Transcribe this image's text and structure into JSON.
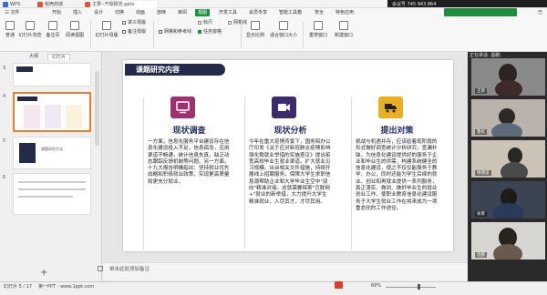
{
  "titlebar": {
    "tabs": [
      {
        "label": "WPS",
        "color": "#2e6fe0"
      },
      {
        "label": "稻壳商城",
        "color": "#e0533a"
      },
      {
        "label": "主要--开题报告.pptx",
        "color": "#e0533a"
      }
    ],
    "meeting": "会议号 745 943 864"
  },
  "menubar": {
    "items": [
      "三 文件",
      "开始",
      "插入",
      "设计",
      "切换",
      "动画",
      "放映",
      "审阅",
      "视图",
      "开发工具",
      "会员专享",
      "智能工具箱",
      "安全",
      "特色应用"
    ],
    "active_index": 8,
    "right": "已"
  },
  "ribbon": {
    "big_buttons": [
      "普通",
      "幻灯片浏览",
      "备注页",
      "阅读视图",
      "幻灯片母版",
      "讲义母版",
      "备注母版",
      "网格和参考线",
      "任务窗格",
      "显示比例",
      "适合窗口大小",
      "重排窗口",
      "新建窗口"
    ],
    "small_items": [
      "标尺",
      "网格线",
      "参考线",
      "任务窗格"
    ],
    "checkboxes": [
      "标尺",
      "网格线",
      "参考线"
    ]
  },
  "leftpanel": {
    "tabs": [
      "大纲",
      "幻灯片"
    ],
    "active_tab": 1,
    "thumbs": [
      {
        "num": "3",
        "text": "",
        "selected": false
      },
      {
        "num": "4",
        "text": "",
        "selected": true
      },
      {
        "num": "5",
        "text": "课题研究方法",
        "selected": false
      },
      {
        "num": "6",
        "text": "",
        "selected": false
      }
    ],
    "add_slide": "+"
  },
  "slide": {
    "title": "课题研究内容",
    "cards": [
      {
        "title": "现状调查",
        "badge_color": "#a0306e",
        "icon": "tv-icon",
        "body": "一方面，信息化服务平台建设存在信息化建设投入不足，信息孤岛，应用渠道不畅通，统计信息失真，缺乏动态跟踪反馈机制等问题。另一方面，十九大报告明确指出：坚持就业优先战略和积极就业政策，实现更高质量和更充分就业。"
      },
      {
        "title": "现状分析",
        "badge_color": "#3b2a6e",
        "icon": "camera-icon",
        "body": "今年在重大疫情背景下，国务院办公厅印发《关于应对新冠肺炎疫情影响强化稳就业举措的实施意见》提出拓宽高校毕业生就业渠道。扩大就业见习规模。出台相关文件措施，持续开展线上招聘服务，保障大学生求职信息源帮助企业和大学毕业生空中\"双向\"精准对接。这就需要探索\"互联网+\"就业的新举措，大力提升大学生精准就业，人尽其才，才尽其用。"
      },
      {
        "title": "提出对策",
        "badge_color": "#e8b021",
        "icon": "truck-icon",
        "body": "挑战与机遇并存，应该趁着现阶段的形式做好调查统计分析研究，查漏补缺，为信息化建设提供好的服务于企业和毕业生的供需，构建系统健全的信息化建设，使之不仅仅能服务于教学、办公，同时还能为学生后续的就业、创业和再就业提供一系列服务，真正落实、做到、做好毕业生的就业创业工作，使职业教育信息化建设服务于大学生就业工作在将来成为一项重态化的工作途径。"
      }
    ]
  },
  "notes": {
    "placeholder": "单击此处添加备注"
  },
  "statusbar": {
    "slide_info": "幻灯片 5 / 17",
    "theme": "第一PPT - www.1ppt.com",
    "zoom": "68%",
    "zoom_fraction": 0.68
  },
  "videopanel": {
    "speaker": "正在讲话: 昌鹏;",
    "participants": [
      {
        "name": "王荣"
      },
      {
        "name": "鲁松"
      },
      {
        "name": "杨德波"
      },
      {
        "name": "徐景"
      },
      {
        "name": "昌鹏"
      }
    ]
  },
  "colors": {
    "accent": "#1e8e3e",
    "slide_dark": "#232a4a",
    "select": "#f07c2a"
  }
}
